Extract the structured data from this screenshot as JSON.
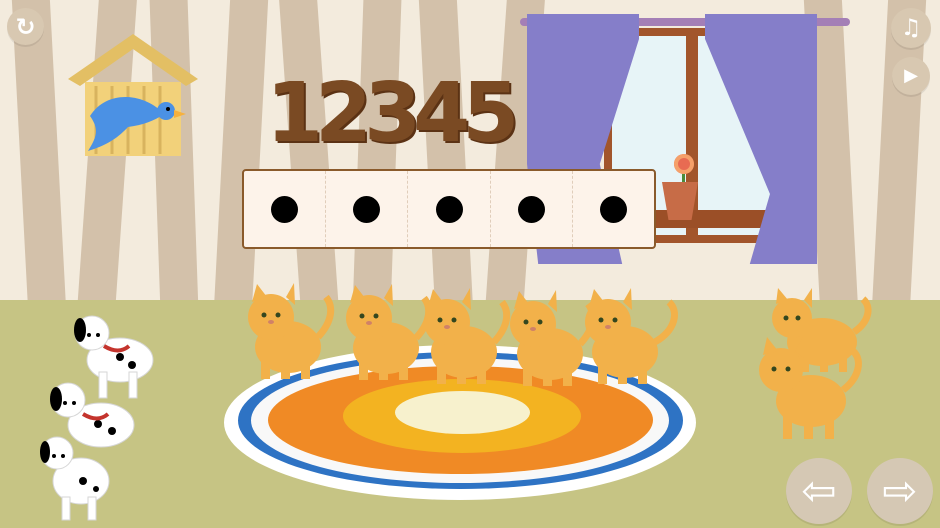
{
  "title_number": "12345",
  "buttons": {
    "restart": "restart-icon",
    "music": "music-off-icon",
    "play": "play-icon",
    "back": "arrow-left-icon",
    "next": "arrow-right-icon"
  },
  "counting_board": {
    "dots": 5
  },
  "cats_on_rug": 5,
  "cats_on_right": 2,
  "dogs": 3,
  "colors": {
    "number": "#7a4a23",
    "board_border": "#8a5a2b",
    "cat": "#f2b14a",
    "rug_blue": "#2e73c4",
    "rug_orange": "#f08a25",
    "rug_yellow": "#f3b321",
    "bird": "#4b91e4",
    "curtain": "#857ec9"
  }
}
